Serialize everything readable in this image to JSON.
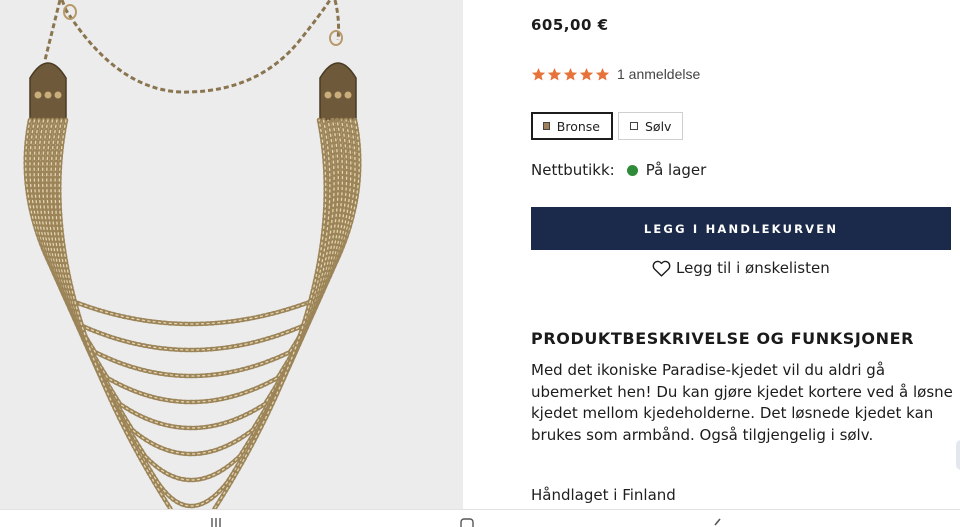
{
  "product": {
    "price": "605,00 €",
    "rating": {
      "stars": 5,
      "max": 5,
      "review_count_label": "1 anmeldelse"
    },
    "variants": [
      {
        "label": "Bronse",
        "selected": true,
        "swatch_color": "#a0805a"
      },
      {
        "label": "Sølv",
        "selected": false,
        "swatch_color": "#ffffff"
      }
    ],
    "stock": {
      "label": "Nettbutikk:",
      "status": "På lager",
      "status_color": "#2f8a3a"
    },
    "add_to_cart_label": "LEGG I HANDLEKURVEN",
    "wishlist_label": "Legg til i ønskelisten",
    "description_title": "PRODUKTBESKRIVELSE OG FUNKSJONER",
    "description": "Med det ikoniske Paradise-kjedet vil du aldri gå ubemerket hen! Du kan gjøre kjedet kortere ved å løsne kjedet mellom kjedeholderne. Det løsnede kjedet kan brukes som armbånd. Også tilgjengelig i sølv.",
    "origin": "Håndlaget i Finland"
  },
  "colors": {
    "star": "#e8733a",
    "button_bg": "#1b2a4a",
    "image_bg": "#ececec"
  },
  "icons": {
    "wishlist": "heart-outline-icon",
    "bottom_nav": [
      "menu-icon",
      "home-icon",
      "back-icon"
    ]
  }
}
